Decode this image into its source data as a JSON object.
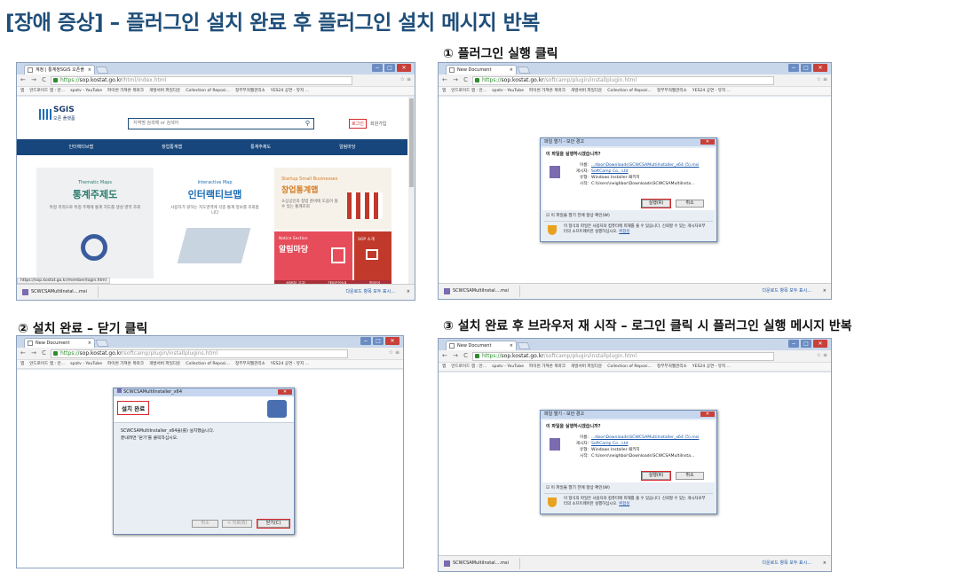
{
  "title": "[장애 증상] – 플러그인 설치 완료 후 플러그인 설치 메시지 반복",
  "captions": {
    "step1": "① 플러그인 실행 클릭",
    "step2": "② 설치 완료 – 닫기 클릭",
    "step3": "③ 설치 완료 후 브라우저 재 시작 – 로그인 클릭 시 플러그인 실행 메시지 반복"
  },
  "colors": {
    "title": "#1f4e79",
    "highlight": "#d9262b",
    "sgis_nav": "#17467c"
  },
  "bookmarks": [
    "앱",
    "안드로이드 앱 : 안...",
    "spotv - YouTube",
    "파이썬 가져온 북마크",
    "개발서버 파일다운",
    "Collection of Reposi...",
    "정부부처웹관리소",
    "YES24 공연 - 뮤지 ..."
  ],
  "download": {
    "file": "SCWCSAMultiInstal....msi",
    "show_all": "다운로드 항목 모두 표시...",
    "close": "×"
  },
  "window_controls": [
    "−",
    "□",
    "✕"
  ],
  "shot1": {
    "tab": "계정 | 통계정SGIS 오픈플",
    "https": "https://",
    "host": "sop.kostat.go.kr",
    "path": "/html/index.html",
    "logo": "SGIS",
    "logo_sub": "오픈 플랫폼",
    "search_placeholder": "지역명 검색해 or 검색어",
    "login": "로그인",
    "join": "회원가입",
    "nav": [
      "인터랙티브맵",
      "창업통계맵",
      "통계주제도",
      "알림마당"
    ],
    "card1_en": "Thematic Maps",
    "card1": "통계주제도",
    "card1_desc": "특정 목적으로 특정 주제에 통계 지도를 생성 영역 조회",
    "card2_en": "Interactive Map",
    "card2": "인터랙티브맵",
    "card2_desc": "사용자가 원하는 지도영역에 각종 통계 정보를 조회합니다",
    "card3_en": "Startup Small Businesses",
    "card3": "창업통계맵",
    "card3_desc": "소상공인의 창업 준비에 도움이 될 수 있는 통계조회",
    "notice_en": "Notice Section",
    "notice": "알림마당",
    "sop": "SOP 소개",
    "bottom": [
      "설명회 공지",
      "데이터안내",
      "참문의"
    ],
    "status_url": "https://sop.kostat.go.kr/member/login.html"
  },
  "plugin_page": {
    "tab": "New Document",
    "https": "https://",
    "host": "sop.kostat.go.kr",
    "path": "/softcamp/plugin/installplugin.html"
  },
  "plugin_page2": {
    "path": "/softcamp/plugin/installplugins.html"
  },
  "security_dialog": {
    "title": "파일 열기 - 보안 경고",
    "question": "이 파일을 실행하시겠습니까?",
    "name_label": "이름:",
    "name": "...hbor\\Downloads\\SCWCSAMultiInstaller_x64 (5).msi",
    "publisher_label": "게시자:",
    "publisher": "SoftCamp Co., Ltd",
    "type_label": "유형:",
    "type": "Windows Installer 패키지",
    "from_label": "시작:",
    "from": "C:\\Users\\neighbor\\Downloads\\SCWCSAMultiInsta...",
    "run": "실행(R)",
    "cancel": "취소",
    "checkbox": "이 파일을 열기 전에 항상 확인(W)",
    "warning": "이 형식의 파일은 사용자의 컴퓨터에 피해를 줄 수 있습니다. 신뢰할 수 있는 게시자로부터의 소프트웨어만 실행하십시오.",
    "risk_link": "위험성"
  },
  "install_dialog": {
    "title": "SCWCSAMultiInstaller_x64",
    "heading": "설치 완료",
    "line1": "SCWCSAMultiInstaller_x64을(를) 설치했습니다.",
    "line2": "끝내려면 '닫기'를 클릭하십시오.",
    "cancel": "취소",
    "back": "< 뒤로(B)",
    "close": "닫기(C)"
  }
}
